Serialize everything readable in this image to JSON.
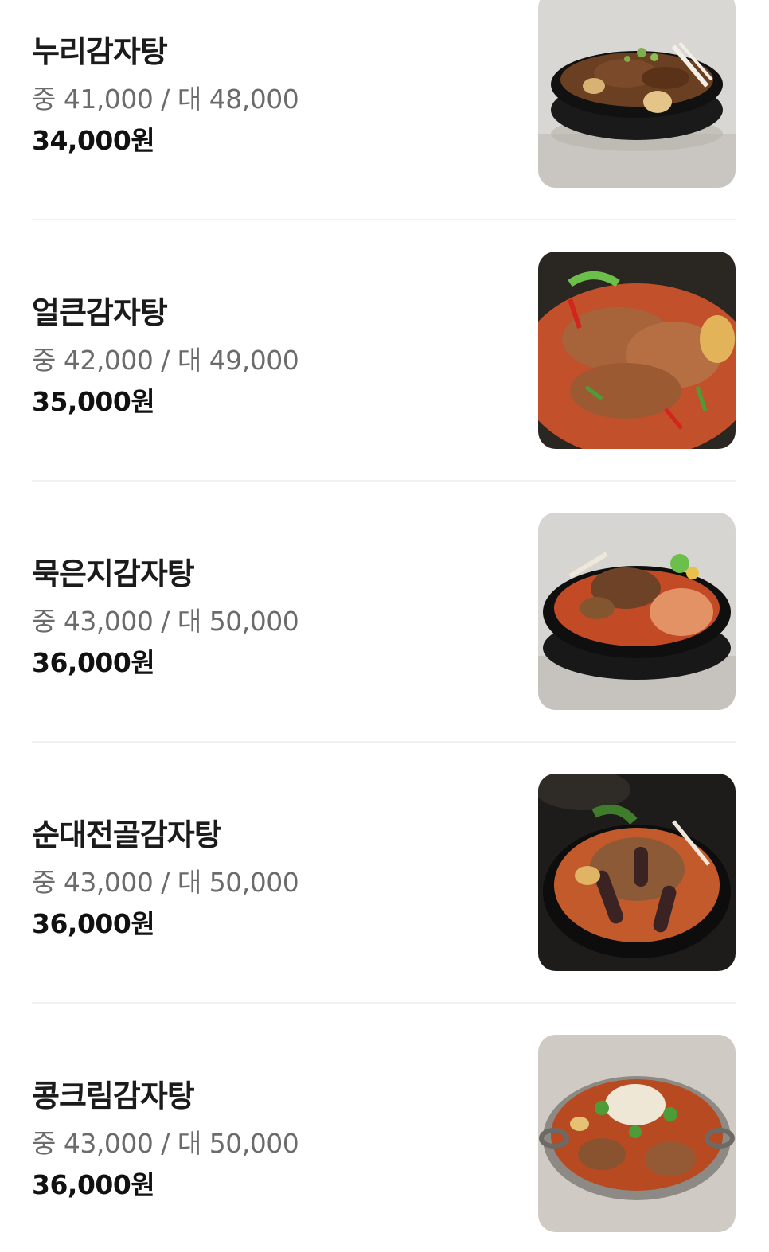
{
  "menu": {
    "items": [
      {
        "name": "누리감자탕",
        "sub_price": "중 41,000 / 대 48,000",
        "price": "34,000원",
        "image": "nuri-gamjatang-photo"
      },
      {
        "name": "얼큰감자탕",
        "sub_price": "중 42,000 / 대 49,000",
        "price": "35,000원",
        "image": "eolkeun-gamjatang-photo"
      },
      {
        "name": "묵은지감자탕",
        "sub_price": "중 43,000 / 대 50,000",
        "price": "36,000원",
        "image": "mugeunji-gamjatang-photo"
      },
      {
        "name": "순대전골감자탕",
        "sub_price": "중 43,000 / 대 50,000",
        "price": "36,000원",
        "image": "sundae-jeongol-gamjatang-photo"
      },
      {
        "name": "콩크림감자탕",
        "sub_price": "중 43,000 / 대 50,000",
        "price": "36,000원",
        "image": "kong-cream-gamjatang-photo"
      }
    ]
  },
  "colors": {
    "name_text": "#1b1b1b",
    "sub_price_text": "#6b6b6b",
    "price_text": "#111111",
    "divider": "#f1f1f1"
  }
}
